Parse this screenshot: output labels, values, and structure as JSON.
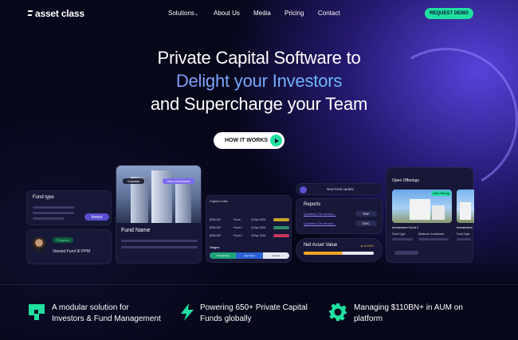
{
  "nav": {
    "logo": "asset class",
    "items": [
      "Solutions",
      "About Us",
      "Media",
      "Pricing",
      "Contact"
    ],
    "cta": "REQUEST DEMO"
  },
  "hero": {
    "line1": "Private Capital Software to",
    "line2": "Delight your Investors",
    "line3": "and Supercharge your Team",
    "button": "HOW IT WORKS"
  },
  "cards": {
    "fund_type": {
      "title": "Fund type",
      "button": "Invest"
    },
    "prospect": {
      "badge": "Prospect",
      "text": "Viewed Fund III PPM"
    },
    "fund_name": {
      "chip1": "Success",
      "chip2": "View Investment",
      "title": "Fund Name"
    },
    "capital_calls": {
      "title": "Capital Calls",
      "rows": [
        {
          "amount": "$150,000",
          "fund": "Fund I",
          "date": "15 Apr 2024",
          "status_color": "#c9a227"
        },
        {
          "amount": "$250,000",
          "fund": "Fund 2",
          "date": "16 Apr 2024",
          "status_color": "#2d8f6a"
        },
        {
          "amount": "$450,000",
          "fund": "Fund 3",
          "date": "18 Apr 2024",
          "status_color": "#c9365c"
        }
      ],
      "stages_title": "Stages",
      "stages": [
        "Prospecting",
        "Approved",
        "Closed"
      ]
    },
    "update": {
      "text": "New fund update"
    },
    "reports": {
      "title": "Reports",
      "rows": [
        {
          "link": "Quarterly Tax returns...",
          "tag": "PDF"
        },
        {
          "link": "Quarterly Tax returns...",
          "tag": "DOC"
        }
      ]
    },
    "nav": {
      "title": "Net Asset Value",
      "value": "▲ 8.44%",
      "progress": 0.55
    },
    "open_offerings": {
      "title": "Open Offerings",
      "badge": "New Offering",
      "name1": "Investment Fund 1",
      "name2": "Investment",
      "labels": [
        "Fund Type",
        "Minimum Investment",
        "Fund Type"
      ]
    }
  },
  "features": [
    {
      "icon": "modular-icon",
      "text": "A modular solution for Investors & Fund Management"
    },
    {
      "icon": "lightning-icon",
      "text": "Powering 650+ Private Capital Funds globally"
    },
    {
      "icon": "gear-icon",
      "text": "Managing $110BN+ in AUM on platform"
    }
  ],
  "colors": {
    "accent": "#1fe0a0",
    "purple": "#5a4fcf",
    "background": "#07071a"
  }
}
